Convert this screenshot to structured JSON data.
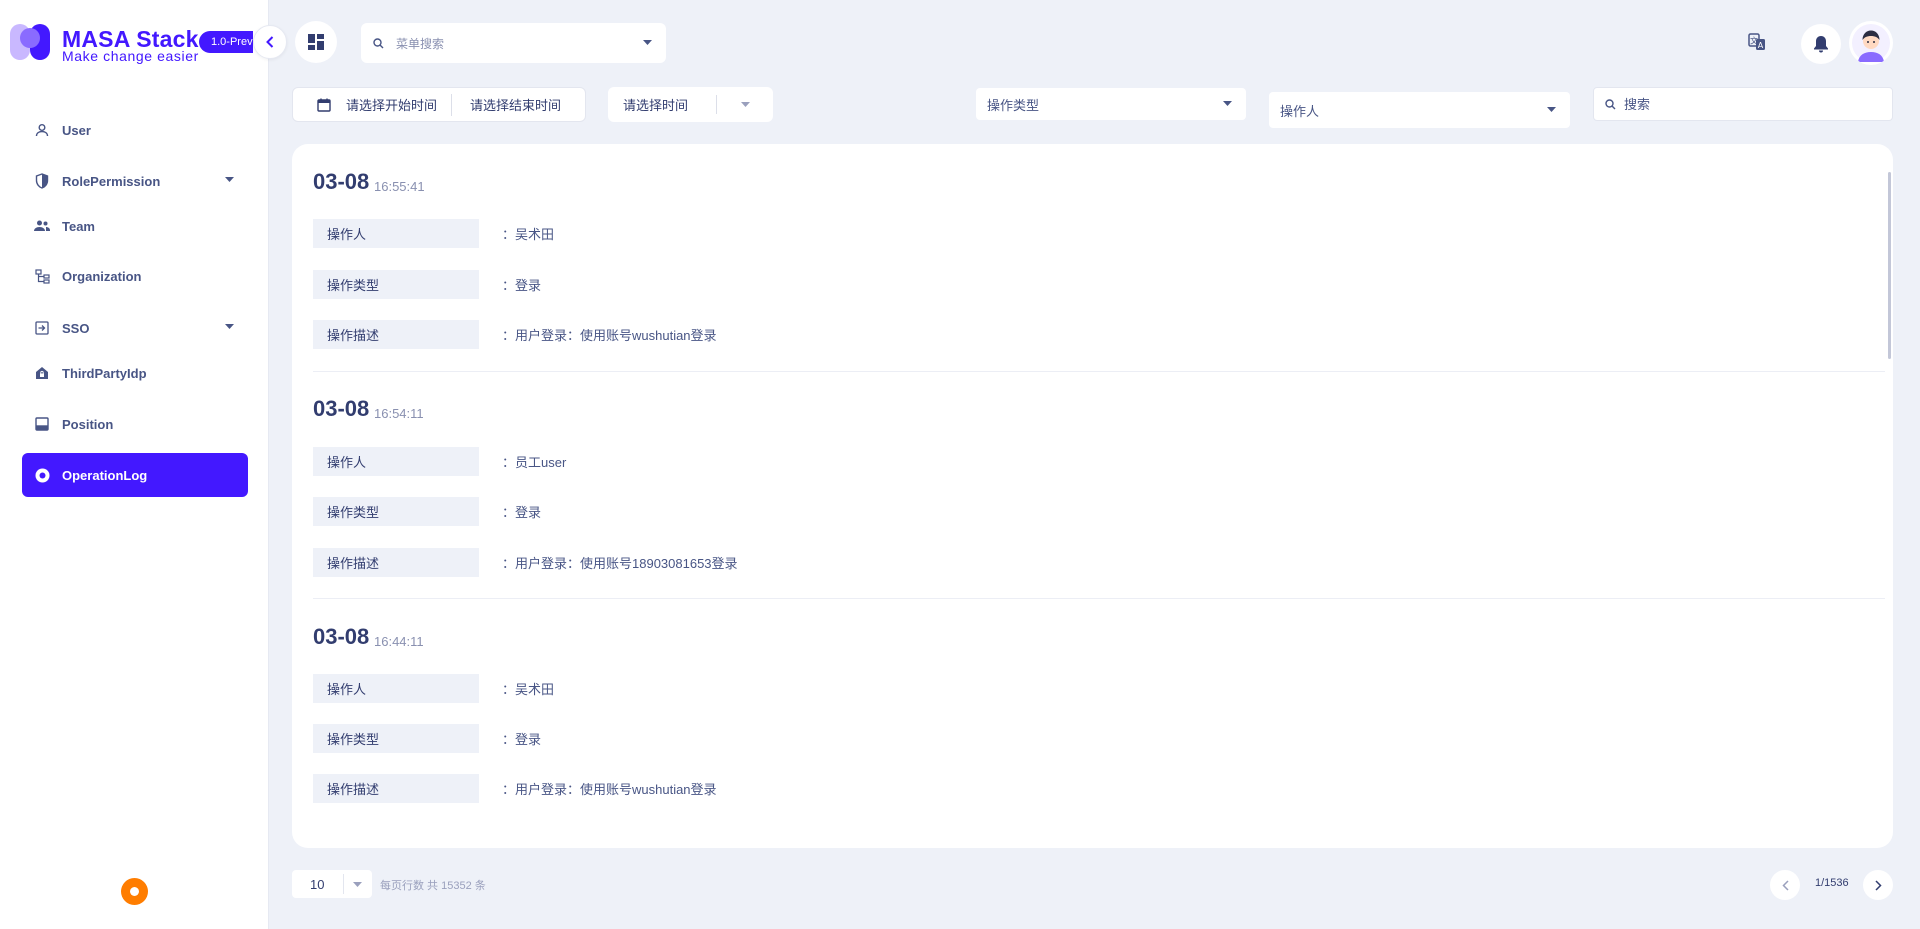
{
  "brand": {
    "title": "MASA Stack",
    "subtitle": "Make change easier",
    "version": "1.0-Prev",
    "accent_color": "#4318ff"
  },
  "sidebar": {
    "items": [
      {
        "label": "User",
        "icon": "user-icon",
        "has_caret": false
      },
      {
        "label": "RolePermission",
        "icon": "shield-icon",
        "has_caret": true
      },
      {
        "label": "Team",
        "icon": "team-icon",
        "has_caret": false
      },
      {
        "label": "Organization",
        "icon": "organization-icon",
        "has_caret": false
      },
      {
        "label": "SSO",
        "icon": "login-icon",
        "has_caret": true
      },
      {
        "label": "ThirdPartyIdp",
        "icon": "home-lock-icon",
        "has_caret": false
      },
      {
        "label": "Position",
        "icon": "position-icon",
        "has_caret": false
      },
      {
        "label": "OperationLog",
        "icon": "record-icon",
        "has_caret": false,
        "active": true
      }
    ]
  },
  "header": {
    "menu_search_placeholder": "菜单搜索"
  },
  "filters": {
    "start_time_placeholder": "请选择开始时间",
    "end_time_placeholder": "请选择结束时间",
    "time_select_placeholder": "请选择时间",
    "operation_type_placeholder": "操作类型",
    "operator_placeholder": "操作人",
    "search_placeholder": "搜索"
  },
  "field_labels": {
    "operator": "操作人",
    "operation_type": "操作类型",
    "description": "操作描述"
  },
  "logs": [
    {
      "date": "03-08",
      "time": "16:55:41",
      "operator": "：吴术田",
      "operation_type": "：登录",
      "description": "：用户登录：使用账号wushutian登录"
    },
    {
      "date": "03-08",
      "time": "16:54:11",
      "operator": "：员工user",
      "operation_type": "：登录",
      "description": "：用户登录：使用账号18903081653登录"
    },
    {
      "date": "03-08",
      "time": "16:44:11",
      "operator": "：吴术田",
      "operation_type": "：登录",
      "description": "：用户登录：使用账号wushutian登录"
    }
  ],
  "pagination": {
    "page_size": "10",
    "info": "每页行数  共 15352 条",
    "current": "1/1536"
  }
}
